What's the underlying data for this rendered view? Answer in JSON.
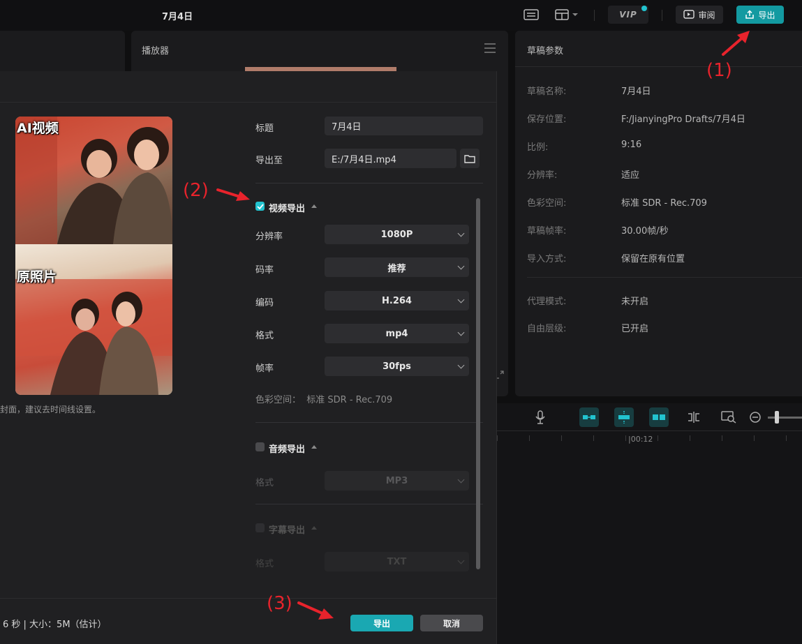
{
  "header": {
    "draft_title": "7月4日",
    "vip_label": "VIP",
    "review_label": "审阅",
    "export_label": "导出"
  },
  "player": {
    "title": "播放器"
  },
  "params": {
    "title": "草稿参数",
    "rows": [
      {
        "label": "草稿名称:",
        "value": "7月4日"
      },
      {
        "label": "保存位置:",
        "value": "F:/JianyingPro Drafts/7月4日"
      },
      {
        "label": "比例:",
        "value": "9:16"
      },
      {
        "label": "分辨率:",
        "value": "适应"
      },
      {
        "label": "色彩空间:",
        "value": "标准 SDR - Rec.709"
      },
      {
        "label": "草稿帧率:",
        "value": "30.00帧/秒"
      },
      {
        "label": "导入方式:",
        "value": "保留在原有位置"
      },
      {
        "label": "代理模式:",
        "value": "未开启"
      },
      {
        "label": "自由层级:",
        "value": "已开启"
      }
    ]
  },
  "timeline": {
    "time_marker": "|00:12"
  },
  "dialog": {
    "preview": {
      "top_label": "AI视频",
      "bottom_label": "原照片"
    },
    "cover_hint": "封面，建议去时间线设置。",
    "size_info": "6 秒 | 大小：5M（估计）",
    "title_label": "标题",
    "title_value": "7月4日",
    "export_to_label": "导出至",
    "export_to_value": "E:/7月4日.mp4",
    "video_section": {
      "title": "视频导出",
      "checked": true,
      "fields": [
        {
          "label": "分辨率",
          "value": "1080P"
        },
        {
          "label": "码率",
          "value": "推荐"
        },
        {
          "label": "编码",
          "value": "H.264"
        },
        {
          "label": "格式",
          "value": "mp4"
        },
        {
          "label": "帧率",
          "value": "30fps"
        }
      ],
      "color_space": "色彩空间：  标准 SDR - Rec.709"
    },
    "audio_section": {
      "title": "音频导出",
      "checked": false,
      "format_label": "格式",
      "format_value": "MP3"
    },
    "subtitle_section": {
      "title": "字幕导出",
      "checked": false,
      "format_label": "格式",
      "format_value": "TXT"
    },
    "export_button": "导出",
    "cancel_button": "取消"
  },
  "annotations": [
    "(1)",
    "(2)",
    "(3)"
  ],
  "colors": {
    "accent": "#1aa8b2",
    "annotation": "#e8232c"
  }
}
